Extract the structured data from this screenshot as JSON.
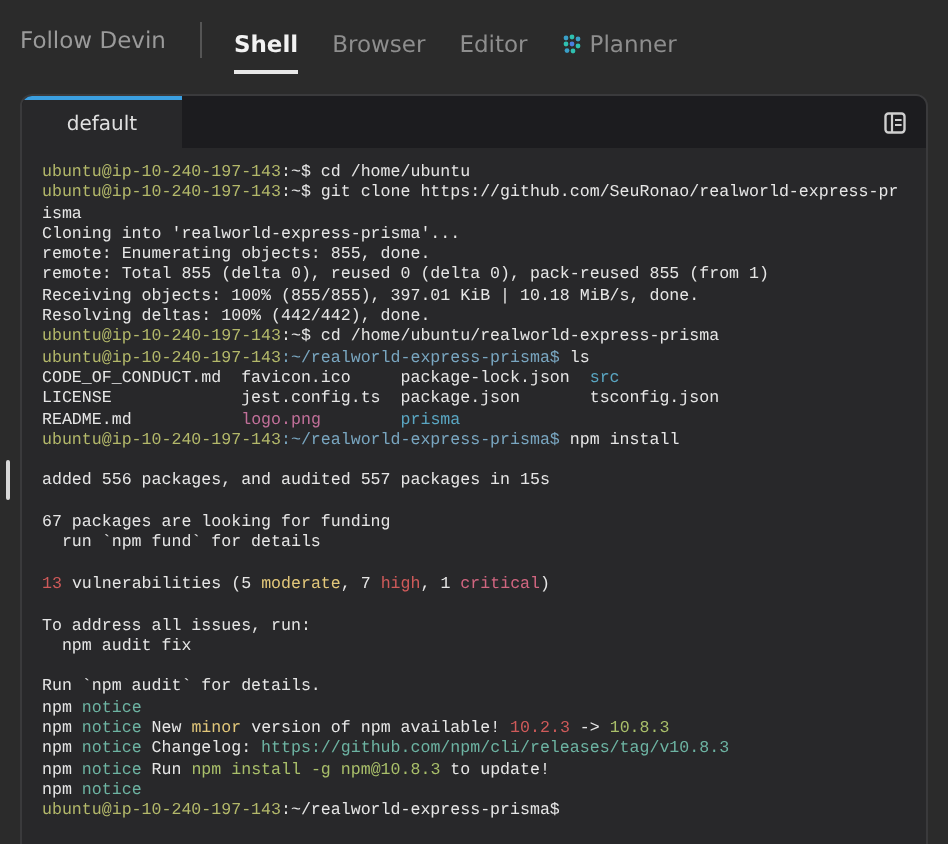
{
  "header": {
    "follow_label": "Follow Devin",
    "tabs": [
      {
        "label": "Shell",
        "selected": true,
        "icon": false
      },
      {
        "label": "Browser",
        "selected": false,
        "icon": false
      },
      {
        "label": "Editor",
        "selected": false,
        "icon": false
      },
      {
        "label": "Planner",
        "selected": false,
        "icon": true
      }
    ]
  },
  "terminal": {
    "tabs": [
      {
        "label": "default",
        "selected": true
      }
    ],
    "lines": [
      {
        "kind": "text",
        "segments": [
          {
            "kind": "user",
            "text": "ubuntu@ip-10-240-197-143"
          },
          {
            "kind": "plain",
            "text": ":~$ cd /home/ubuntu"
          }
        ]
      },
      {
        "kind": "text",
        "segments": [
          {
            "kind": "user",
            "text": "ubuntu@ip-10-240-197-143"
          },
          {
            "kind": "plain",
            "text": ":~$ git clone https://github.com/SeuRonao/realworld-express-pr"
          }
        ]
      },
      {
        "kind": "text",
        "segments": [
          {
            "kind": "plain",
            "text": "isma"
          }
        ]
      },
      {
        "kind": "text",
        "segments": [
          {
            "kind": "plain",
            "text": "Cloning into 'realworld-express-prisma'..."
          }
        ]
      },
      {
        "kind": "text",
        "segments": [
          {
            "kind": "plain",
            "text": "remote: Enumerating objects: 855, done."
          }
        ]
      },
      {
        "kind": "text",
        "segments": [
          {
            "kind": "plain",
            "text": "remote: Total 855 (delta 0), reused 0 (delta 0), pack-reused 855 (from 1)"
          }
        ]
      },
      {
        "kind": "text",
        "segments": [
          {
            "kind": "plain",
            "text": "Receiving objects: 100% (855/855), 397.01 KiB | 10.18 MiB/s, done."
          }
        ]
      },
      {
        "kind": "text",
        "segments": [
          {
            "kind": "plain",
            "text": "Resolving deltas: 100% (442/442), done."
          }
        ]
      },
      {
        "kind": "text",
        "segments": [
          {
            "kind": "user",
            "text": "ubuntu@ip-10-240-197-143"
          },
          {
            "kind": "plain",
            "text": ":~$ cd /home/ubuntu/realworld-express-prisma"
          }
        ]
      },
      {
        "kind": "text",
        "segments": [
          {
            "kind": "user",
            "text": "ubuntu@ip-10-240-197-143"
          },
          {
            "kind": "path",
            "text": ":~/realworld-express-prisma$"
          },
          {
            "kind": "plain",
            "text": " ls"
          }
        ]
      },
      {
        "kind": "text",
        "segments": [
          {
            "kind": "plain",
            "text": "CODE_OF_CONDUCT.md  favicon.ico     package-lock.json  "
          },
          {
            "kind": "dir",
            "text": "src"
          }
        ]
      },
      {
        "kind": "text",
        "segments": [
          {
            "kind": "plain",
            "text": "LICENSE             jest.config.ts  package.json       tsconfig.json"
          }
        ]
      },
      {
        "kind": "text",
        "segments": [
          {
            "kind": "plain",
            "text": "README.md           "
          },
          {
            "kind": "media",
            "text": "logo.png        "
          },
          {
            "kind": "dir",
            "text": "prisma"
          }
        ]
      },
      {
        "kind": "text",
        "segments": [
          {
            "kind": "user",
            "text": "ubuntu@ip-10-240-197-143"
          },
          {
            "kind": "path",
            "text": ":~/realworld-express-prisma$"
          },
          {
            "kind": "plain",
            "text": " npm install"
          }
        ]
      },
      {
        "kind": "blank"
      },
      {
        "kind": "text",
        "segments": [
          {
            "kind": "plain",
            "text": "added 556 packages, and audited 557 packages in 15s"
          }
        ]
      },
      {
        "kind": "blank"
      },
      {
        "kind": "text",
        "segments": [
          {
            "kind": "plain",
            "text": "67 packages are looking for funding"
          }
        ]
      },
      {
        "kind": "text",
        "segments": [
          {
            "kind": "plain",
            "text": "  run `npm fund` for details"
          }
        ]
      },
      {
        "kind": "blank"
      },
      {
        "kind": "text",
        "segments": [
          {
            "kind": "error",
            "text": "13"
          },
          {
            "kind": "plain",
            "text": " vulnerabilities (5 "
          },
          {
            "kind": "warn",
            "text": "moderate"
          },
          {
            "kind": "plain",
            "text": ", 7 "
          },
          {
            "kind": "error",
            "text": "high"
          },
          {
            "kind": "plain",
            "text": ", 1 "
          },
          {
            "kind": "critical",
            "text": "critical"
          },
          {
            "kind": "plain",
            "text": ")"
          }
        ]
      },
      {
        "kind": "blank"
      },
      {
        "kind": "text",
        "segments": [
          {
            "kind": "plain",
            "text": "To address all issues, run:"
          }
        ]
      },
      {
        "kind": "text",
        "segments": [
          {
            "kind": "plain",
            "text": "  npm audit fix"
          }
        ]
      },
      {
        "kind": "blank"
      },
      {
        "kind": "text",
        "segments": [
          {
            "kind": "plain",
            "text": "Run `npm audit` for details."
          }
        ]
      },
      {
        "kind": "text",
        "segments": [
          {
            "kind": "plain",
            "text": "npm "
          },
          {
            "kind": "info",
            "text": "notice"
          }
        ]
      },
      {
        "kind": "text",
        "segments": [
          {
            "kind": "plain",
            "text": "npm "
          },
          {
            "kind": "info",
            "text": "notice"
          },
          {
            "kind": "plain",
            "text": " New "
          },
          {
            "kind": "warn",
            "text": "minor"
          },
          {
            "kind": "plain",
            "text": " version of npm available! "
          },
          {
            "kind": "error",
            "text": "10.2.3"
          },
          {
            "kind": "plain",
            "text": " -> "
          },
          {
            "kind": "ok",
            "text": "10.8.3"
          }
        ]
      },
      {
        "kind": "text",
        "segments": [
          {
            "kind": "plain",
            "text": "npm "
          },
          {
            "kind": "info",
            "text": "notice"
          },
          {
            "kind": "plain",
            "text": " Changelog: "
          },
          {
            "kind": "info",
            "text": "https://github.com/npm/cli/releases/tag/v10.8.3"
          }
        ]
      },
      {
        "kind": "text",
        "segments": [
          {
            "kind": "plain",
            "text": "npm "
          },
          {
            "kind": "info",
            "text": "notice"
          },
          {
            "kind": "plain",
            "text": " Run "
          },
          {
            "kind": "ok",
            "text": "npm install -g npm@10.8.3"
          },
          {
            "kind": "plain",
            "text": " to update!"
          }
        ]
      },
      {
        "kind": "text",
        "segments": [
          {
            "kind": "plain",
            "text": "npm "
          },
          {
            "kind": "info",
            "text": "notice"
          }
        ]
      },
      {
        "kind": "text",
        "segments": [
          {
            "kind": "user",
            "text": "ubuntu@ip-10-240-197-143"
          },
          {
            "kind": "plain",
            "text": ":~/realworld-express-prisma$"
          }
        ]
      }
    ]
  }
}
